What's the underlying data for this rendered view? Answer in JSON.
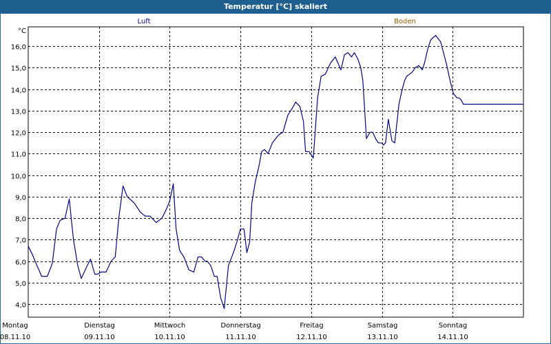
{
  "header": {
    "title": "Temperatur [°C] skaliert"
  },
  "chart_data": {
    "type": "line",
    "title": "Temperatur [°C] skaliert",
    "y_unit": "°C",
    "ylim": [
      3.4,
      16.9
    ],
    "y_ticks": [
      "4,0",
      "5,0",
      "6,0",
      "7,0",
      "8,0",
      "9,0",
      "10,0",
      "11,0",
      "12,0",
      "13,0",
      "14,0",
      "15,0",
      "16,0"
    ],
    "y_tick_values": [
      4,
      5,
      6,
      7,
      8,
      9,
      10,
      11,
      12,
      13,
      14,
      15,
      16
    ],
    "xlim": [
      0,
      7
    ],
    "x_labels": [
      {
        "day": "Montag",
        "date": "08.11.10"
      },
      {
        "day": "Dienstag",
        "date": "09.11.10"
      },
      {
        "day": "Mittwoch",
        "date": "10.11.10"
      },
      {
        "day": "Donnerstag",
        "date": "11.11.10"
      },
      {
        "day": "Freitag",
        "date": "12.11.10"
      },
      {
        "day": "Samstag",
        "date": "13.11.10"
      },
      {
        "day": "Sonntag",
        "date": "14.11.10"
      }
    ],
    "grid": true,
    "legend_position": "top",
    "series": [
      {
        "name": "Luft",
        "color": "#00008b",
        "x": [
          0.0,
          0.06,
          0.11,
          0.19,
          0.27,
          0.34,
          0.4,
          0.45,
          0.52,
          0.58,
          0.61,
          0.64,
          0.7,
          0.75,
          0.82,
          0.88,
          0.94,
          0.98,
          1.03,
          1.1,
          1.17,
          1.23,
          1.28,
          1.34,
          1.4,
          1.5,
          1.58,
          1.65,
          1.72,
          1.81,
          1.89,
          1.95,
          2.0,
          2.05,
          2.09,
          2.14,
          2.2,
          2.27,
          2.34,
          2.4,
          2.45,
          2.5,
          2.53,
          2.58,
          2.63,
          2.67,
          2.72,
          2.77,
          2.83,
          2.9,
          2.95,
          3.0,
          3.05,
          3.09,
          3.13,
          3.16,
          3.21,
          3.26,
          3.3,
          3.34,
          3.39,
          3.45,
          3.52,
          3.55,
          3.6,
          3.67,
          3.73,
          3.78,
          3.84,
          3.89,
          3.92,
          3.97,
          4.03,
          4.09,
          4.14,
          4.2,
          4.27,
          4.34,
          4.42,
          4.47,
          4.52,
          4.57,
          4.61,
          4.66,
          4.7,
          4.73,
          4.78,
          4.83,
          4.87,
          4.91,
          4.95,
          5.0,
          5.02,
          5.05,
          5.09,
          5.14,
          5.18,
          5.24,
          5.28,
          5.32,
          5.35,
          5.39,
          5.43,
          5.47,
          5.52,
          5.57,
          5.6,
          5.65,
          5.69,
          5.76,
          5.83,
          5.91,
          5.97,
          6.01,
          6.06,
          6.09,
          6.12,
          6.15,
          6.19,
          6.25,
          6.3,
          6.33,
          6.36,
          6.42,
          6.47,
          6.52,
          6.57,
          6.62,
          6.66,
          6.71,
          6.75,
          6.82,
          6.89,
          6.94,
          7.0
        ],
        "y": [
          6.7,
          6.3,
          5.9,
          5.3,
          5.3,
          5.9,
          7.5,
          7.9,
          8.0,
          8.9,
          7.9,
          7.0,
          5.8,
          5.2,
          5.7,
          6.1,
          5.4,
          5.4,
          5.5,
          5.5,
          6.0,
          6.2,
          8.0,
          9.5,
          9.0,
          8.7,
          8.3,
          8.1,
          8.1,
          7.8,
          8.0,
          8.4,
          8.8,
          9.6,
          7.5,
          6.5,
          6.2,
          5.6,
          5.5,
          6.2,
          6.2,
          6.0,
          6.0,
          5.8,
          5.3,
          5.3,
          4.3,
          3.8,
          5.8,
          6.4,
          6.9,
          7.5,
          7.5,
          6.4,
          6.9,
          8.7,
          9.7,
          10.4,
          11.1,
          11.2,
          11.0,
          11.5,
          11.8,
          11.9,
          12.0,
          12.8,
          13.1,
          13.4,
          13.2,
          12.5,
          11.1,
          11.1,
          10.8,
          13.6,
          14.6,
          14.7,
          15.2,
          15.5,
          14.9,
          15.6,
          15.7,
          15.5,
          15.7,
          15.4,
          15.0,
          14.4,
          11.7,
          12.0,
          12.0,
          11.7,
          11.5,
          11.5,
          11.4,
          11.5,
          12.6,
          11.6,
          11.5,
          13.3,
          13.9,
          14.4,
          14.6,
          14.7,
          14.8,
          15.0,
          15.1,
          14.9,
          15.2,
          15.9,
          16.3,
          16.5,
          16.2,
          15.2,
          14.3,
          13.8,
          13.6,
          13.6,
          13.5,
          13.3,
          13.3,
          13.3,
          13.3,
          13.3,
          13.3,
          13.3,
          13.3,
          13.3,
          13.3,
          13.3,
          13.3,
          13.3,
          13.3,
          13.3,
          13.3,
          13.3,
          13.3
        ]
      },
      {
        "name": "Boden",
        "color": "#9c5a00",
        "x": [],
        "y": []
      }
    ]
  }
}
